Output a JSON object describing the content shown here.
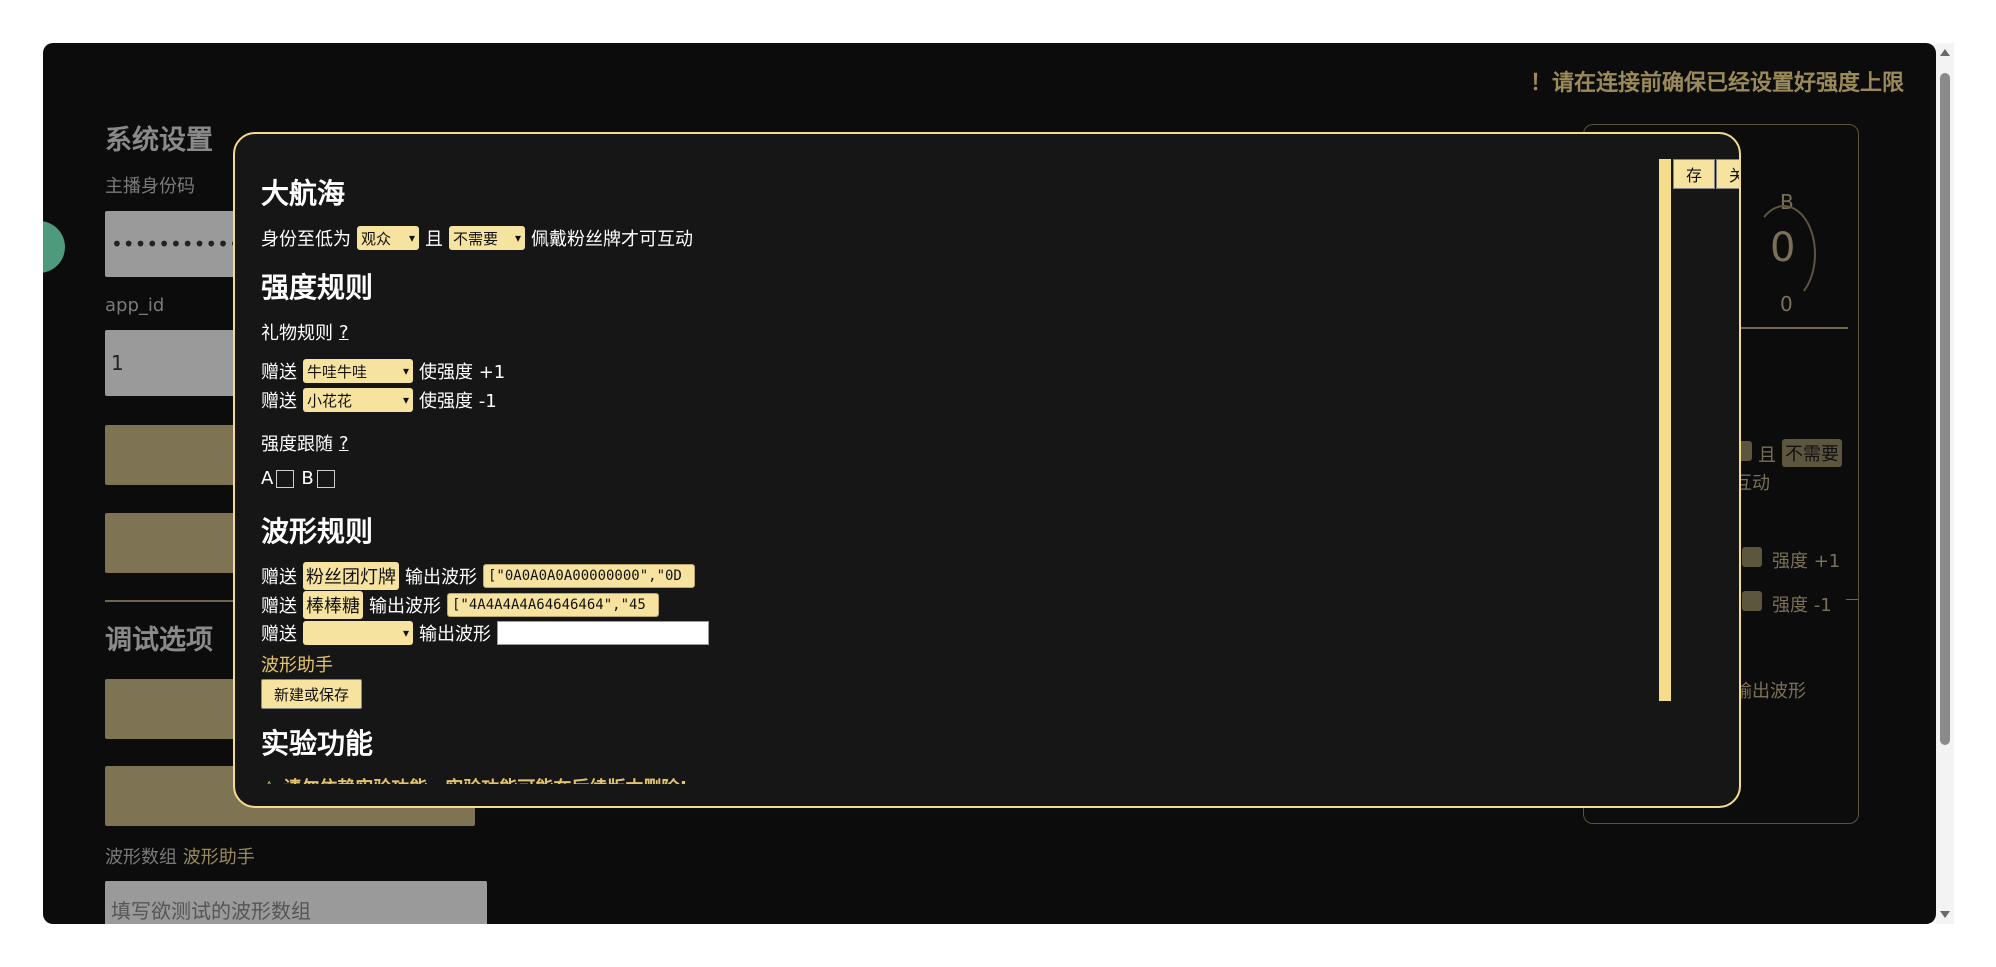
{
  "background": {
    "warning": "！请在连接前确保已经设置好强度上限",
    "system_title": "系统设置",
    "host_code_label": "主播身份码",
    "host_code_value": "••••••••••••",
    "app_id_label": "app_id",
    "app_id_value": "1",
    "debug_title": "调试选项",
    "wave_array_label": "波形数组",
    "wave_helper_label": "波形助手",
    "wave_placeholder": "填写欲测试的波形数组",
    "right_panel": {
      "channel": "B",
      "value": "0",
      "max": "0",
      "and": "且",
      "no_need": "不需要",
      "interact": "互动",
      "inc": "强度 +1",
      "dec": "强度 -1",
      "output_wave": "输出波形"
    }
  },
  "modal": {
    "save_button": "存",
    "close_button": "关",
    "guard_title": "大航海",
    "guard_prefix": "身份至低为",
    "guard_identity": "观众",
    "guard_and": "且",
    "guard_medal": "不需要",
    "guard_suffix": "佩戴粉丝牌才可互动",
    "strength_title": "强度规则",
    "gift_rule_label": "礼物规则",
    "question_mark": "?",
    "gift_rules": [
      {
        "give": "赠送",
        "gift": "牛哇牛哇",
        "effect": "使强度 +1"
      },
      {
        "give": "赠送",
        "gift": "小花花",
        "effect": "使强度 -1"
      }
    ],
    "follow_label": "强度跟随",
    "channel_a": "A",
    "channel_b": "B",
    "wave_title": "波形规则",
    "wave_rules": [
      {
        "give": "赠送",
        "gift": "粉丝团灯牌",
        "output": "输出波形",
        "wave": "[\"0A0A0A0A00000000\",\"0D"
      },
      {
        "give": "赠送",
        "gift": "棒棒糖",
        "output": "输出波形",
        "wave": "[\"4A4A4A4A64646464\",\"45"
      }
    ],
    "new_rule": {
      "give": "赠送",
      "gift": "",
      "output": "输出波形",
      "wave": ""
    },
    "wave_helper": "波形助手",
    "new_or_save": "新建或保存",
    "experiment_title": "实验功能",
    "experiment_warning": "⚠ 请勿依赖实验功能，实验功能可能在后续版本删除!"
  }
}
